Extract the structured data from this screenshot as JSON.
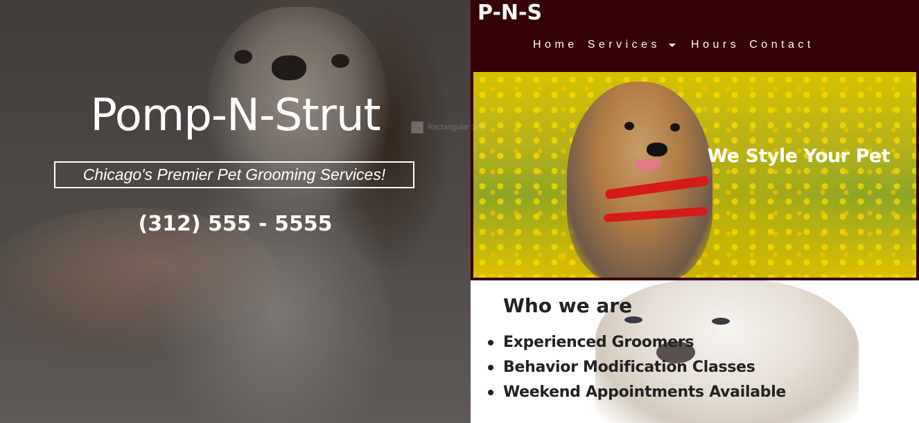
{
  "hero": {
    "title": "Pomp-N-Strut",
    "tagline": "Chicago's Premier Pet Grooming Services!",
    "phone": "(312) 555 - 5555",
    "broken_image_alt": "Rectangular Snip"
  },
  "header": {
    "logo": "P-N-S",
    "nav": [
      {
        "label": "Home"
      },
      {
        "label": "Services",
        "has_dropdown": true
      },
      {
        "label": "Hours"
      },
      {
        "label": "Contact"
      }
    ],
    "background_color": "#350306"
  },
  "banner": {
    "caption": "We Style Your Pet"
  },
  "about": {
    "title": "Who we are",
    "items": [
      "Experienced Groomers",
      "Behavior Modification Classes",
      "Weekend Appointments Available"
    ]
  }
}
